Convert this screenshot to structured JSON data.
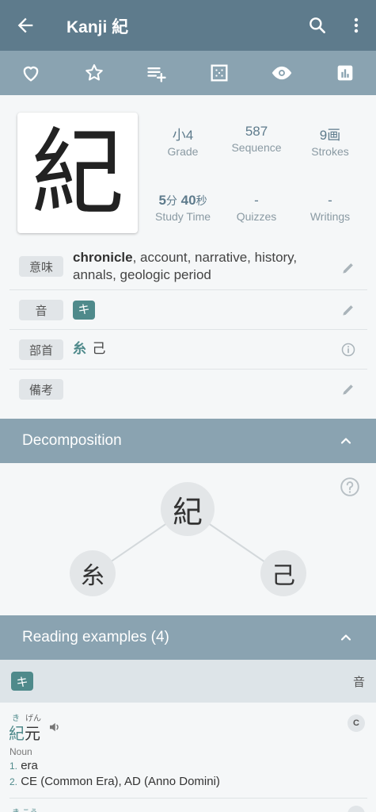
{
  "app_bar": {
    "title": "Kanji 紀"
  },
  "kanji": {
    "character": "紀"
  },
  "stats": [
    {
      "value": "小4",
      "label": "Grade"
    },
    {
      "value": "587",
      "label": "Sequence"
    },
    {
      "value": "9画",
      "label": "Strokes"
    },
    {
      "value_num1": "5",
      "value_unit1": "分",
      "value_num2": "40",
      "value_unit2": "秒",
      "label": "Study Time"
    },
    {
      "value": "-",
      "label": "Quizzes"
    },
    {
      "value": "-",
      "label": "Writings"
    }
  ],
  "rows": {
    "meaning": {
      "chip": "意味",
      "bold": "chronicle",
      "rest": ", account, narrative, history,",
      "line2": "annals, geologic period"
    },
    "on": {
      "chip": "音",
      "kana": "キ"
    },
    "radical": {
      "chip": "部首",
      "radical": "糸",
      "other": "己"
    },
    "notes": {
      "chip": "備考"
    }
  },
  "decomposition": {
    "title": "Decomposition",
    "root": "紀",
    "left": "糸",
    "right": "己"
  },
  "reading_examples": {
    "title": "Reading examples (4)",
    "reading_kana": "キ",
    "reading_type": "音",
    "example": {
      "furigana_1": "き",
      "furigana_2": "げん",
      "word_1": "紀",
      "word_2": "元",
      "pos": "Noun",
      "def1_num": "1.",
      "def1": "era",
      "def2_num": "2.",
      "def2": "CE (Common Era), AD (Anno Domini)",
      "badge": "C"
    },
    "next_furigana": "き こう"
  },
  "colors": {
    "appbar": "#5e7b8c",
    "toolbar": "#8aa3b1",
    "accent": "#4f8a8b",
    "background": "#f5f7f8"
  }
}
